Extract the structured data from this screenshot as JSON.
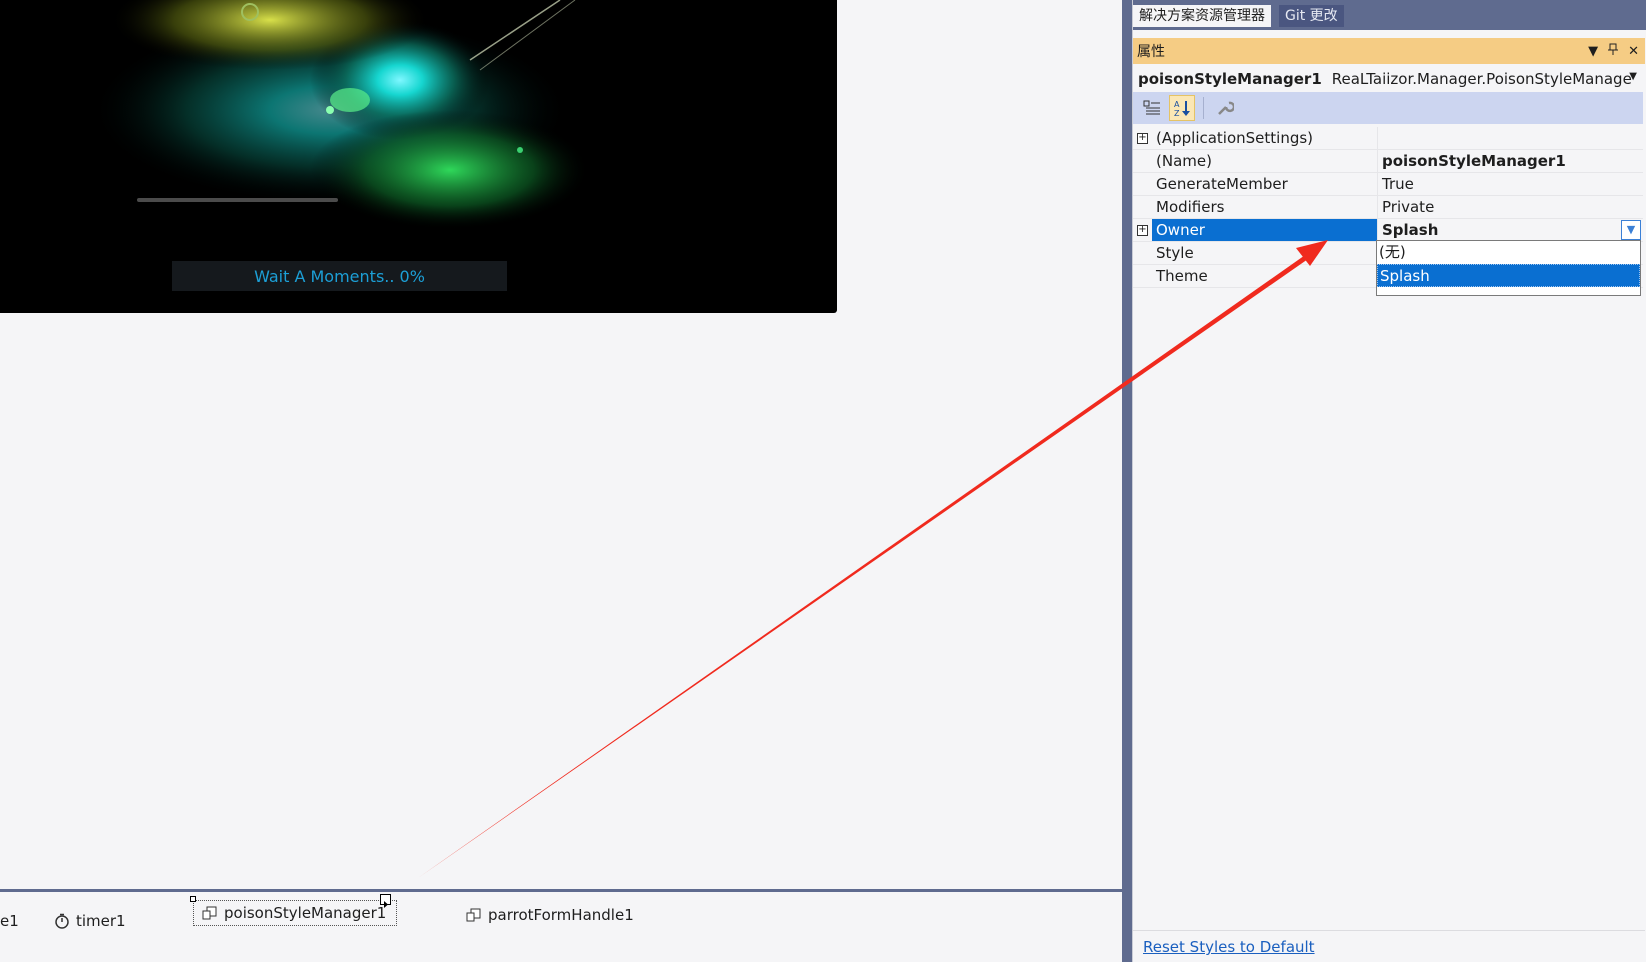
{
  "splash": {
    "loading_text": "Wait A Moments.. 0%",
    "progress_percent": 0
  },
  "tray": {
    "partial_item": "e1",
    "items": [
      {
        "label": "timer1",
        "icon": "timer-icon"
      },
      {
        "label": "poisonStyleManager1",
        "icon": "component-icon",
        "selected": true
      },
      {
        "label": "parrotFormHandle1",
        "icon": "component-icon"
      }
    ]
  },
  "panel": {
    "tabs": [
      {
        "label": "解决方案资源管理器",
        "active": true
      },
      {
        "label": "Git 更改",
        "active": false
      }
    ],
    "title": "属性",
    "object_name": "poisonStyleManager1",
    "object_type": "ReaLTaiizor.Manager.PoisonStyleManage",
    "properties": [
      {
        "name": "(ApplicationSettings)",
        "value": "",
        "expandable": true
      },
      {
        "name": "(Name)",
        "value": "poisonStyleManager1",
        "bold": true
      },
      {
        "name": "GenerateMember",
        "value": "True"
      },
      {
        "name": "Modifiers",
        "value": "Private"
      },
      {
        "name": "Owner",
        "value": "Splash",
        "bold": true,
        "expandable": true,
        "selected": true
      },
      {
        "name": "Style",
        "value": ""
      },
      {
        "name": "Theme",
        "value": ""
      }
    ],
    "dropdown_options": [
      {
        "label": "(无)",
        "selected": false
      },
      {
        "label": "Splash",
        "selected": true
      }
    ],
    "reset_link": "Reset Styles to Default"
  },
  "colors": {
    "accent": "#0a6fd1",
    "titlebar": "#f5cc84",
    "arrow": "#f02a1e",
    "loading_text": "#1c9fd6"
  }
}
